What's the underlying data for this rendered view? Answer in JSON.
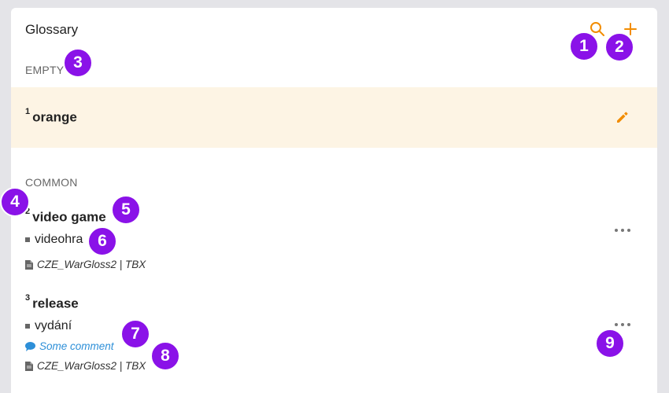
{
  "header": {
    "title": "Glossary",
    "search_icon": "search-icon",
    "add_icon": "plus-icon"
  },
  "sections": {
    "empty_label": "EMPTY",
    "common_label": "COMMON"
  },
  "entries": [
    {
      "number": "1",
      "term": "orange",
      "highlighted": true,
      "action_icon": "pencil-icon"
    },
    {
      "number": "2",
      "term": "video game",
      "translation": "videohra",
      "source": "CZE_WarGloss2 | TBX",
      "action_icon": "more-icon"
    },
    {
      "number": "3",
      "term": "release",
      "translation": "vydání",
      "comment": "Some comment",
      "source": "CZE_WarGloss2 | TBX",
      "action_icon": "more-icon"
    }
  ],
  "badges": [
    "1",
    "2",
    "3",
    "4",
    "5",
    "6",
    "7",
    "8",
    "9"
  ],
  "colors": {
    "accent": "#f28c00",
    "highlight_bg": "#fdf4e4",
    "comment": "#2d8fd8",
    "badge": "#8a12e8"
  }
}
